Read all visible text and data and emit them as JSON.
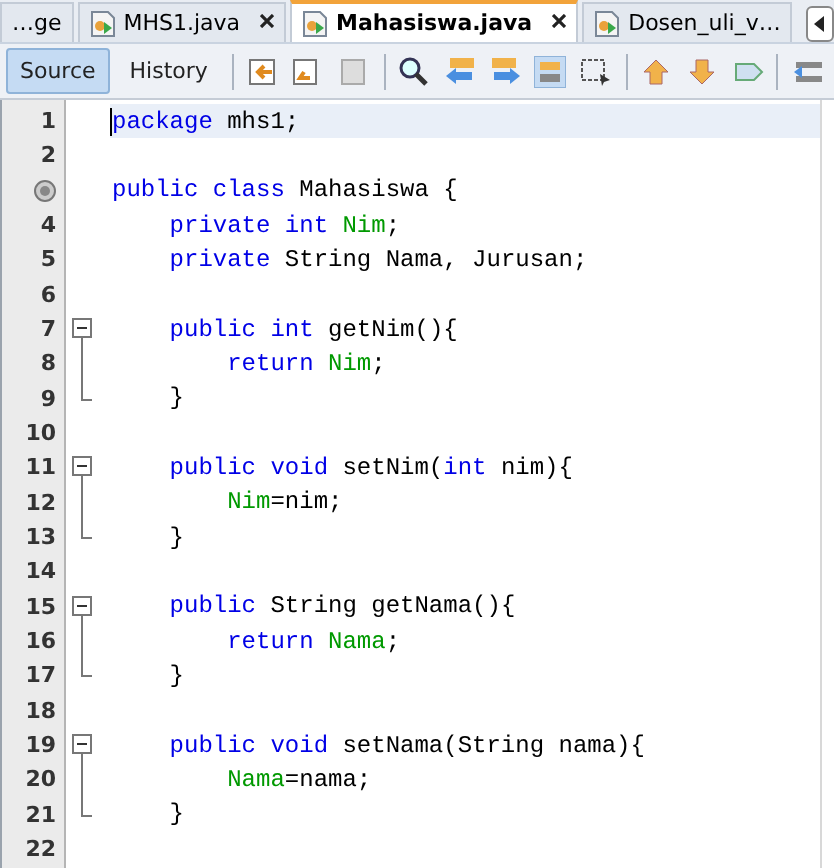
{
  "tabs": [
    {
      "label": "…ge",
      "selected": false,
      "icon": false,
      "closable": false
    },
    {
      "label": "MHS1.java",
      "selected": false,
      "icon": true,
      "closable": true
    },
    {
      "label": "Mahasiswa.java",
      "selected": true,
      "icon": true,
      "closable": true
    },
    {
      "label": "Dosen_uli_v…",
      "selected": false,
      "icon": true,
      "closable": false
    }
  ],
  "toolbar": {
    "views": [
      {
        "label": "Source",
        "selected": true
      },
      {
        "label": "History",
        "selected": false
      }
    ]
  },
  "lines": [
    {
      "number": "1",
      "current": true,
      "kind": "plain",
      "tokens": [
        {
          "kind": "keyword",
          "text": "package "
        },
        {
          "kind": "plain",
          "text": "mhs1;"
        }
      ]
    },
    {
      "number": "2",
      "current": false,
      "kind": "plain"
    },
    {
      "current": false,
      "annotation": true,
      "kind": "plain",
      "tokens": [
        {
          "kind": "keyword",
          "text": "public class "
        },
        {
          "kind": "plain",
          "text": "Mahasiswa {"
        }
      ]
    },
    {
      "number": "4",
      "current": false,
      "kind": "plain",
      "tokens": [
        {
          "kind": "keyword",
          "text": "    private int "
        },
        {
          "kind": "field",
          "text": "Nim"
        },
        {
          "kind": "plain",
          "text": ";"
        }
      ]
    },
    {
      "number": "5",
      "current": false,
      "kind": "plain",
      "tokens": [
        {
          "kind": "keyword",
          "text": "    private "
        },
        {
          "kind": "plain",
          "text": "String Nama, Jurusan;"
        }
      ]
    },
    {
      "number": "6",
      "current": false,
      "kind": "plain"
    },
    {
      "number": "7",
      "current": false,
      "kind": "fold_start",
      "expanded": true,
      "tokens": [
        {
          "kind": "keyword",
          "text": "    public int "
        },
        {
          "kind": "plain",
          "text": "getNim(){"
        }
      ]
    },
    {
      "number": "8",
      "current": false,
      "kind": "fold_body",
      "tokens": [
        {
          "kind": "keyword",
          "text": "        return "
        },
        {
          "kind": "field",
          "text": "Nim"
        },
        {
          "kind": "plain",
          "text": ";"
        }
      ]
    },
    {
      "number": "9",
      "current": false,
      "kind": "fold_end",
      "tokens": [
        {
          "kind": "plain",
          "text": "    }"
        }
      ]
    },
    {
      "number": "10",
      "current": false,
      "kind": "plain"
    },
    {
      "number": "11",
      "current": false,
      "kind": "fold_start",
      "expanded": true,
      "tokens": [
        {
          "kind": "keyword",
          "text": "    public void "
        },
        {
          "kind": "plain",
          "text": "setNim("
        },
        {
          "kind": "keyword",
          "text": "int "
        },
        {
          "kind": "plain",
          "text": "nim){"
        }
      ]
    },
    {
      "number": "12",
      "current": false,
      "kind": "fold_body",
      "tokens": [
        {
          "kind": "field",
          "text": "        Nim"
        },
        {
          "kind": "plain",
          "text": "=nim;"
        }
      ]
    },
    {
      "number": "13",
      "current": false,
      "kind": "fold_end",
      "tokens": [
        {
          "kind": "plain",
          "text": "    }"
        }
      ]
    },
    {
      "number": "14",
      "current": false,
      "kind": "plain"
    },
    {
      "number": "15",
      "current": false,
      "kind": "fold_start",
      "expanded": true,
      "tokens": [
        {
          "kind": "keyword",
          "text": "    public "
        },
        {
          "kind": "plain",
          "text": "String getNama(){"
        }
      ]
    },
    {
      "number": "16",
      "current": false,
      "kind": "fold_body",
      "tokens": [
        {
          "kind": "keyword",
          "text": "        return "
        },
        {
          "kind": "field",
          "text": "Nama"
        },
        {
          "kind": "plain",
          "text": ";"
        }
      ]
    },
    {
      "number": "17",
      "current": false,
      "kind": "fold_end",
      "tokens": [
        {
          "kind": "plain",
          "text": "    }"
        }
      ]
    },
    {
      "number": "18",
      "current": false,
      "kind": "plain"
    },
    {
      "number": "19",
      "current": false,
      "kind": "fold_start",
      "expanded": true,
      "tokens": [
        {
          "kind": "keyword",
          "text": "    public void "
        },
        {
          "kind": "plain",
          "text": "setNama(String nama){"
        }
      ]
    },
    {
      "number": "20",
      "current": false,
      "kind": "fold_body",
      "tokens": [
        {
          "kind": "field",
          "text": "        Nama"
        },
        {
          "kind": "plain",
          "text": "=nama;"
        }
      ]
    },
    {
      "number": "21",
      "current": false,
      "kind": "fold_end",
      "tokens": [
        {
          "kind": "plain",
          "text": "    }"
        }
      ]
    },
    {
      "number": "22",
      "current": false,
      "kind": "plain"
    }
  ]
}
